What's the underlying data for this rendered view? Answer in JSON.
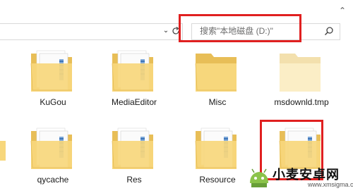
{
  "search": {
    "placeholder": "搜索\"本地磁盘 (D:)\""
  },
  "toolbar": {
    "refresh_icon": "refresh-icon",
    "dropdown_icon": "chevron-down-icon",
    "up_icon": "chevron-up-icon"
  },
  "files": [
    {
      "name": "KuGou",
      "type": "folder-with-docs"
    },
    {
      "name": "MediaEditor",
      "type": "folder-with-docs"
    },
    {
      "name": "Misc",
      "type": "folder"
    },
    {
      "name": "msdownld.tmp",
      "type": "folder-hidden"
    },
    {
      "name": "qycache",
      "type": "folder-with-docs"
    },
    {
      "name": "Res",
      "type": "folder-with-docs"
    },
    {
      "name": "Resource",
      "type": "folder-with-docs"
    },
    {
      "name": "",
      "type": "folder-with-docs"
    }
  ],
  "watermark": {
    "title": "小麦安卓网",
    "url": "www.xmsigma.com"
  },
  "colors": {
    "highlight": "#e02020",
    "folder": "#f7d77c"
  }
}
